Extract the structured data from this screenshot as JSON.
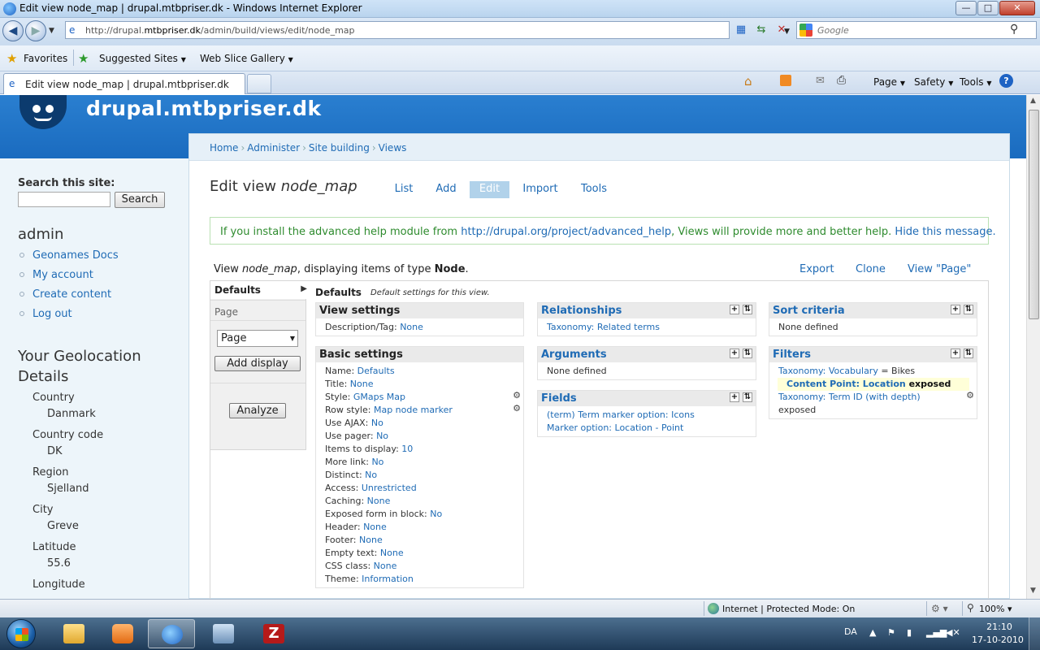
{
  "window": {
    "title": "Edit view node_map | drupal.mtbpriser.dk - Windows Internet Explorer",
    "min": "—",
    "max": "□",
    "close": "✕"
  },
  "address": {
    "url_prefix": "http://drupal.",
    "url_domain": "mtbpriser.dk",
    "url_path": "/admin/build/views/edit/node_map",
    "search_placeholder": "Google"
  },
  "favorites": {
    "label": "Favorites",
    "items": [
      "Suggested Sites",
      "Web Slice Gallery"
    ]
  },
  "tab": {
    "title": "Edit view node_map | drupal.mtbpriser.dk"
  },
  "commandbar": {
    "page": "Page",
    "safety": "Safety",
    "tools": "Tools"
  },
  "site": {
    "name": "drupal.mtbpriser.dk"
  },
  "sidebar": {
    "search_heading": "Search this site:",
    "search_button": "Search",
    "user_heading": "admin",
    "links": [
      "Geonames Docs",
      "My account",
      "Create content",
      "Log out"
    ],
    "geo_heading": "Your Geolocation Details",
    "geo": [
      {
        "label": "Country",
        "value": "Danmark"
      },
      {
        "label": "Country code",
        "value": "DK"
      },
      {
        "label": "Region",
        "value": "Sjelland"
      },
      {
        "label": "City",
        "value": "Greve"
      },
      {
        "label": "Latitude",
        "value": "55.6"
      },
      {
        "label": "Longitude",
        "value": ""
      }
    ]
  },
  "breadcrumb": [
    "Home",
    "Administer",
    "Site building",
    "Views"
  ],
  "page": {
    "title_prefix": "Edit view ",
    "title_name": "node_map",
    "tabs": [
      "List",
      "Add",
      "Edit",
      "Import",
      "Tools"
    ]
  },
  "help": {
    "before": "If you install the advanced help module from ",
    "link": "http://drupal.org/project/advanced_help",
    "after": ", Views will provide more and better help. ",
    "hide": "Hide this message."
  },
  "viewinfo": {
    "prefix": "View ",
    "name": "node_map",
    "middle": ", displaying items of type ",
    "type": "Node",
    "suffix": ".",
    "links": [
      "Export",
      "Clone",
      "View \"Page\""
    ]
  },
  "displays": {
    "defaults": "Defaults",
    "page": "Page",
    "select_value": "Page",
    "add_display": "Add display",
    "analyze": "Analyze"
  },
  "defaults_header": {
    "title": "Defaults",
    "desc": "Default settings for this view."
  },
  "view_settings": {
    "title": "View settings",
    "rows": [
      {
        "label": "Description/Tag:",
        "value": "None"
      }
    ]
  },
  "basic_settings": {
    "title": "Basic settings",
    "rows": [
      {
        "label": "Name:",
        "value": "Defaults"
      },
      {
        "label": "Title:",
        "value": "None"
      },
      {
        "label": "Style:",
        "value": "GMaps Map"
      },
      {
        "label": "Row style:",
        "value": "Map node marker"
      },
      {
        "label": "Use AJAX:",
        "value": "No"
      },
      {
        "label": "Use pager:",
        "value": "No"
      },
      {
        "label": "Items to display:",
        "value": "10"
      },
      {
        "label": "More link:",
        "value": "No"
      },
      {
        "label": "Distinct:",
        "value": "No"
      },
      {
        "label": "Access:",
        "value": "Unrestricted"
      },
      {
        "label": "Caching:",
        "value": "None"
      },
      {
        "label": "Exposed form in block:",
        "value": "No"
      },
      {
        "label": "Header:",
        "value": "None"
      },
      {
        "label": "Footer:",
        "value": "None"
      },
      {
        "label": "Empty text:",
        "value": "None"
      },
      {
        "label": "CSS class:",
        "value": "None"
      },
      {
        "label": "Theme:",
        "value": "Information"
      }
    ]
  },
  "relationships": {
    "title": "Relationships",
    "items": [
      "Taxonomy: Related terms"
    ]
  },
  "arguments": {
    "title": "Arguments",
    "none": "None defined"
  },
  "fields": {
    "title": "Fields",
    "items": [
      "(term) Term marker option: Icons",
      "Marker option: Location - Point"
    ]
  },
  "sort": {
    "title": "Sort criteria",
    "none": "None defined"
  },
  "filters": {
    "title": "Filters",
    "f1_label": "Taxonomy: Vocabulary",
    "f1_op": " = Bikes",
    "f2_label": "Content Point: Location",
    "f2_suffix": " exposed",
    "f3_label": "Taxonomy: Term ID (with depth)",
    "f3_suffix": "exposed"
  },
  "status": {
    "zone": "Internet | Protected Mode: On",
    "zoom": "100%"
  },
  "taskbar": {
    "lang": "DA",
    "time": "21:10",
    "date": "17-10-2010"
  },
  "icons": {
    "action_add": "+",
    "action_rearrange": "⇅",
    "gear": "⚙"
  }
}
